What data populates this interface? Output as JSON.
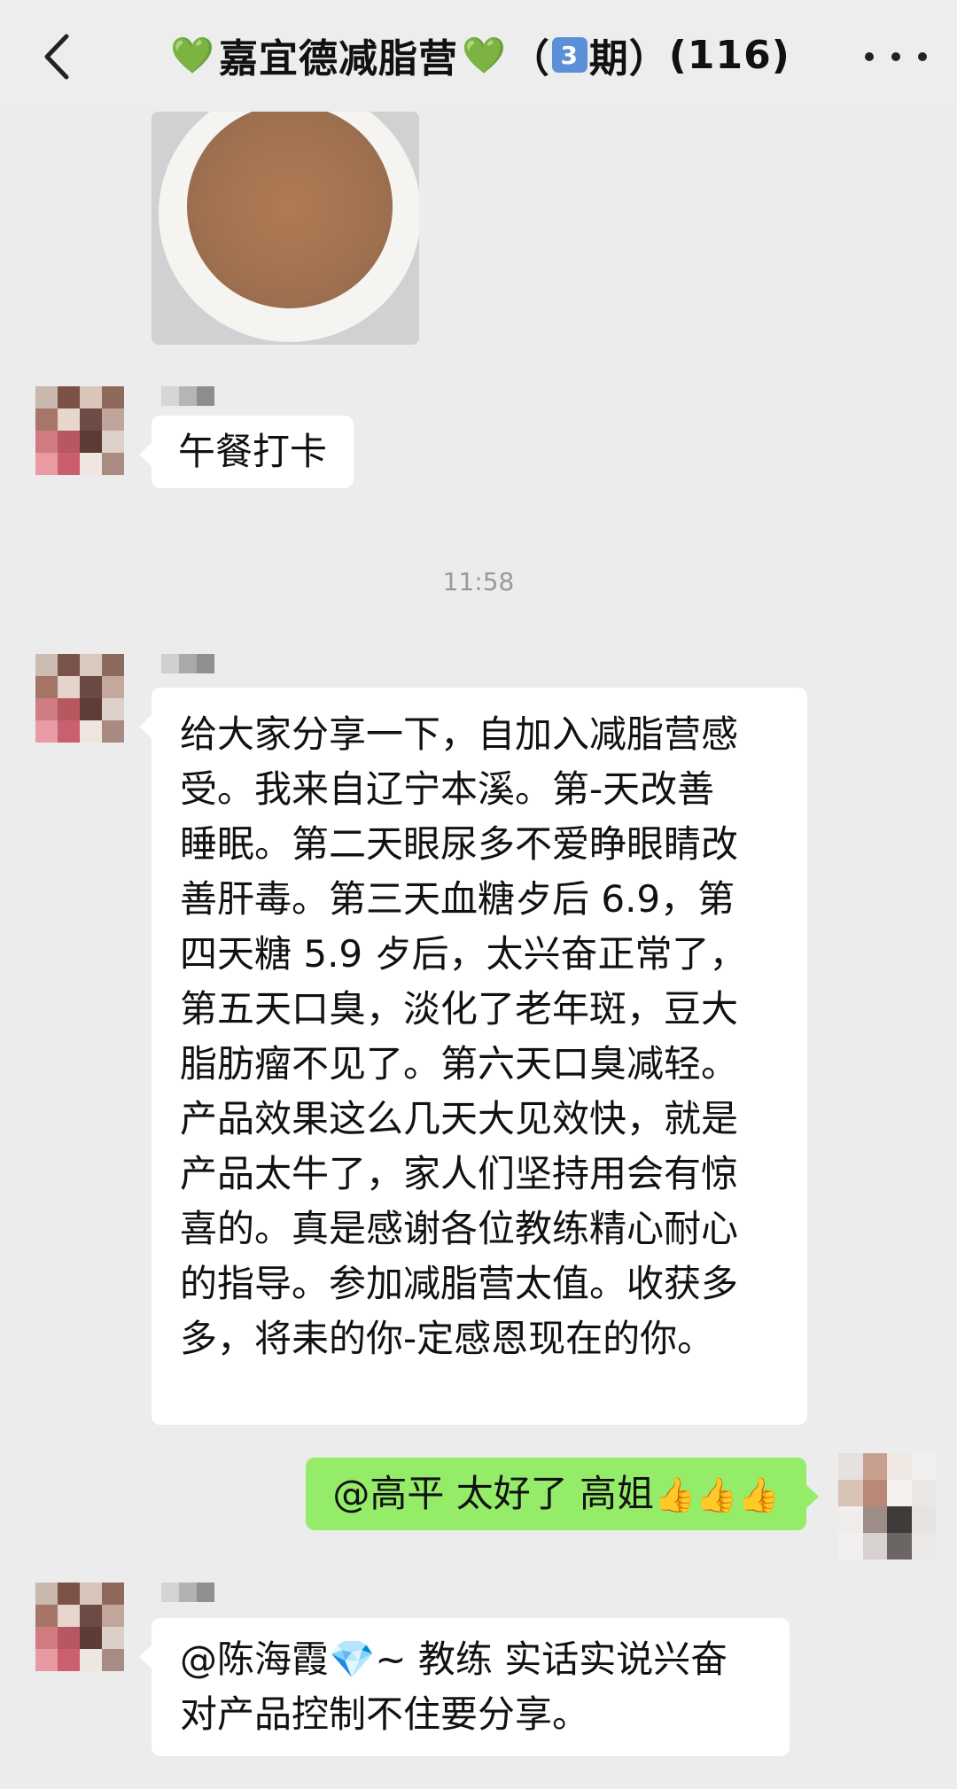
{
  "header": {
    "back_icon": "back-chevron-icon",
    "title_heart": "💚",
    "title_name": "嘉宜德减脂营",
    "title_open": "（",
    "title_keycap": "3",
    "title_period": "期）",
    "title_count": "(116)",
    "more_icon": "more-dots-icon"
  },
  "messages": [
    {
      "id": "m1",
      "type": "image",
      "description_icon": "food-bowl-photo"
    },
    {
      "id": "m2",
      "type": "text",
      "text": "午餐打卡"
    },
    {
      "id": "ts",
      "type": "timestamp",
      "text": "11:58"
    },
    {
      "id": "m3",
      "type": "text",
      "lines": [
        "给大家分享一下，自加入减脂营感",
        "受。我来自辽宁本溪。第-天改善",
        "睡眠。第二天眼尿多不爱睁眼睛改",
        "善肝毒。第三天血糖歺后 6.9，第",
        "四天糖 5.9 歺后，太兴奋正常了，",
        "第五天口臭，淡化了老年斑，豆大",
        "脂肪瘤不见了。第六天口臭减轻。",
        "产品效果这么几天大见效快，就是",
        "产品太牛了，家人们坚持用会有惊",
        "喜的。真是感谢各位教练精心耐心",
        "的指导。参加减脂营太值。收获多",
        "多，将耒的你-定感恩现在的你。"
      ]
    },
    {
      "id": "m4",
      "type": "text",
      "self": true,
      "text": "@高平  太好了 高姐",
      "thumbs": "👍👍👍"
    },
    {
      "id": "m5",
      "type": "text",
      "prefix": "@陈海霞",
      "gem": "💎",
      "lines": [
        "~ 教练  实话实说兴奋",
        "对产品控制不住要分享。"
      ]
    }
  ],
  "colors": {
    "background": "#ececec",
    "bubble_other": "#ffffff",
    "bubble_self": "#95ec69",
    "timestamp": "#9a9a9a"
  }
}
